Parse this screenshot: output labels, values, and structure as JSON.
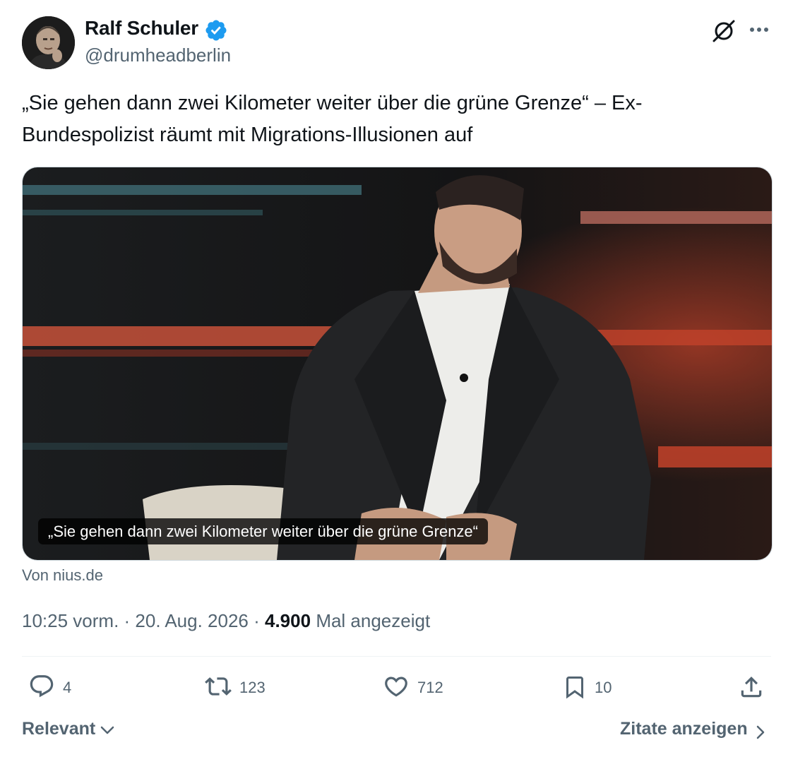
{
  "author": {
    "name": "Ralf Schuler",
    "handle": "@drumheadberlin",
    "verified": true
  },
  "tweet": {
    "text": "„Sie gehen dann zwei Kilometer weiter über die grüne Grenze“ – Ex-Bundespolizist räumt mit Migrations-Illusionen auf"
  },
  "media": {
    "caption": "„Sie gehen dann zwei Kilometer weiter über die grüne Grenze“",
    "source": "Von nius.de"
  },
  "meta": {
    "time": "10:25 vorm.",
    "separator": " · ",
    "date": "20. Aug. 2026",
    "views_count": "4.900",
    "views_label": "Mal angezeigt"
  },
  "actions": {
    "replies": "4",
    "reposts": "123",
    "likes": "712",
    "bookmarks": "10"
  },
  "footer": {
    "sort_label": "Relevant",
    "quotes_label": "Zitate anzeigen"
  },
  "icons": {
    "header": [
      "grok-icon",
      "more-icon"
    ],
    "actions": [
      "reply-icon",
      "repost-icon",
      "like-icon",
      "bookmark-icon",
      "share-icon"
    ],
    "footer": [
      "chevron-down-icon",
      "chevron-right-icon"
    ]
  },
  "colors": {
    "text_primary": "#0f1419",
    "text_secondary": "#536471",
    "verified_blue": "#1d9bf0",
    "divider": "#eff3f4"
  }
}
